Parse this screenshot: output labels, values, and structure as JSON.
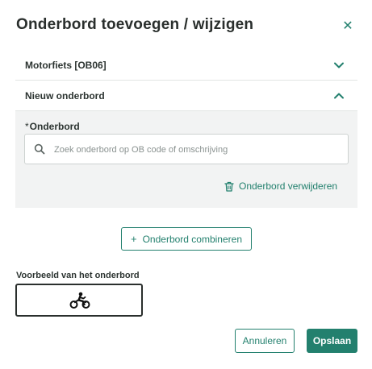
{
  "dialog": {
    "title": "Onderbord toevoegen / wijzigen",
    "close_icon": "close-icon"
  },
  "accordion": [
    {
      "label": "Motorfiets [OB06]",
      "expanded": false
    },
    {
      "label": "Nieuw onderbord",
      "expanded": true
    }
  ],
  "panel": {
    "required_marker": "*",
    "field_label": "Onderbord",
    "search_placeholder": "Zoek onderbord op OB code of omschrijving",
    "search_value": "",
    "remove_label": "Onderbord verwijderen"
  },
  "combine_button": {
    "prefix": "+",
    "label": "Onderbord combineren"
  },
  "preview": {
    "label": "Voorbeeld van het onderbord",
    "icon": "motorcycle-icon"
  },
  "actions": {
    "cancel": "Annuleren",
    "save": "Opslaan"
  },
  "colors": {
    "accent": "#23806e",
    "panel_bg": "#f2f3f3",
    "text": "#2a2f2d"
  }
}
